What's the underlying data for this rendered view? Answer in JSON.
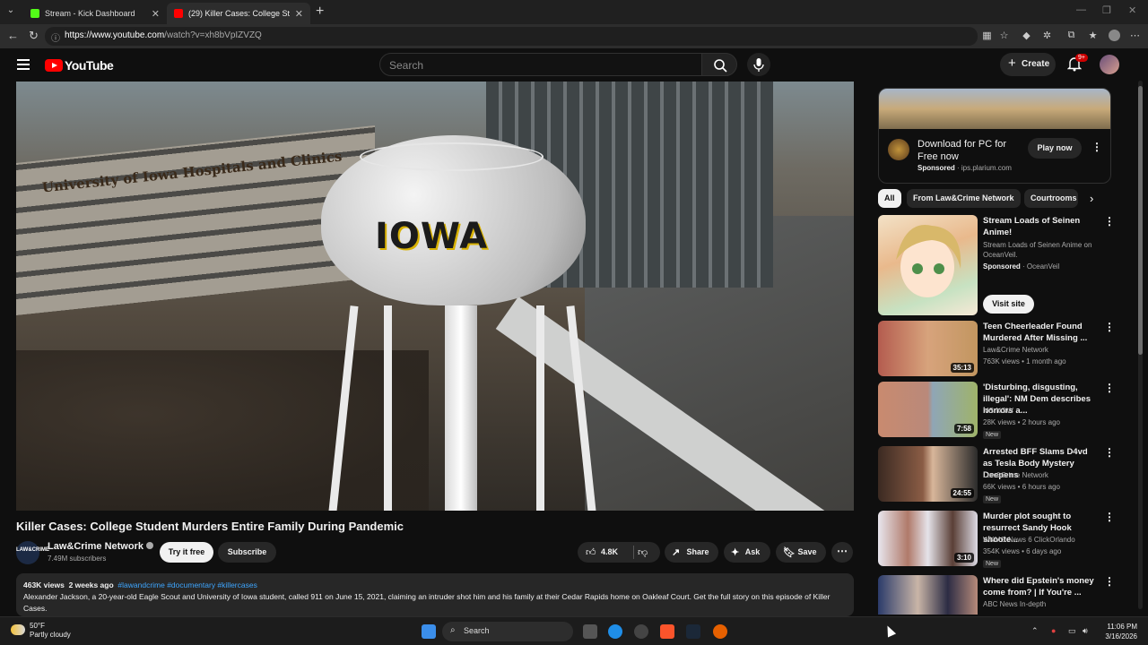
{
  "browser": {
    "tabs": [
      {
        "label": "Stream - Kick Dashboard",
        "favicon_color": "#53fc18"
      },
      {
        "label": "(29) Killer Cases: College Stud",
        "favicon_color": "#ff0000"
      }
    ],
    "url_host": "https://www.youtube.com",
    "url_path": "/watch?v=xh8bVpIZVZQ"
  },
  "header": {
    "logo_text": "YouTube",
    "search_placeholder": "Search",
    "create_label": "Create",
    "notif_badge": "9+"
  },
  "video": {
    "sign_text": "University of Iowa Hospitals and Clinics",
    "tower_text": "IOWA",
    "title": "Killer Cases: College Student Murders Entire Family During Pandemic",
    "channel_avatar_text": "LAW&CRIME",
    "channel": "Law&Crime Network",
    "subscribers": "7.49M subscribers",
    "try_label": "Try it free",
    "subscribe_label": "Subscribe",
    "likes": "4.8K",
    "share_label": "Share",
    "ask_label": "Ask",
    "save_label": "Save",
    "views": "463K views",
    "date": "2 weeks ago",
    "tags": "#lawandcrime #documentary #killercases",
    "description": "Alexander Jackson, a 20-year-old Eagle Scout and University of Iowa student, called 911 on June 15, 2021, claiming an intruder shot him and his family at their Cedar Rapids home on Oakleaf Court. Get the full story on this episode of Killer Cases."
  },
  "sidebar": {
    "ad": {
      "title": "Download for PC for Free now",
      "sponsored": "Sponsored",
      "domain": "ips.plarium.com",
      "button": "Play now"
    },
    "chips": [
      "All",
      "From Law&Crime Network",
      "Courtrooms"
    ],
    "recs": [
      {
        "title": "Stream Loads of Seinen Anime!",
        "line1": "Stream Loads of Seinen Anime on OceanVeil.",
        "line2_bold": "Sponsored",
        "line2": "OceanVeil",
        "button": "Visit site"
      },
      {
        "title": "Teen Cheerleader Found Murdered After Missing ...",
        "channel": "Law&Crime Network",
        "meta": "763K views • 1 month ago",
        "duration": "35:13"
      },
      {
        "title": "'Disturbing, disgusting, illegal': NM Dem describes horrors a...",
        "channel": "MS NOW",
        "meta": "28K views • 2 hours ago",
        "duration": "7:58",
        "badge": "New"
      },
      {
        "title": "Arrested BFF Slams D4vd as Tesla Body Mystery Deepens",
        "channel": "Law&Crime Network",
        "meta": "66K views • 6 hours ago",
        "duration": "24:55",
        "badge": "New"
      },
      {
        "title": "Murder plot sought to resurrect Sandy Hook shoote...",
        "channel": "WKMG News 6 ClickOrlando",
        "meta": "354K views • 6 days ago",
        "duration": "3:10",
        "badge": "New"
      },
      {
        "title": "Where did Epstein's money come from? | If You're ...",
        "channel": "ABC News In-depth"
      }
    ]
  },
  "taskbar": {
    "temp": "50°F",
    "condition": "Partly cloudy",
    "search_label": "Search",
    "time": "11:06 PM",
    "date": "3/16/2026"
  }
}
